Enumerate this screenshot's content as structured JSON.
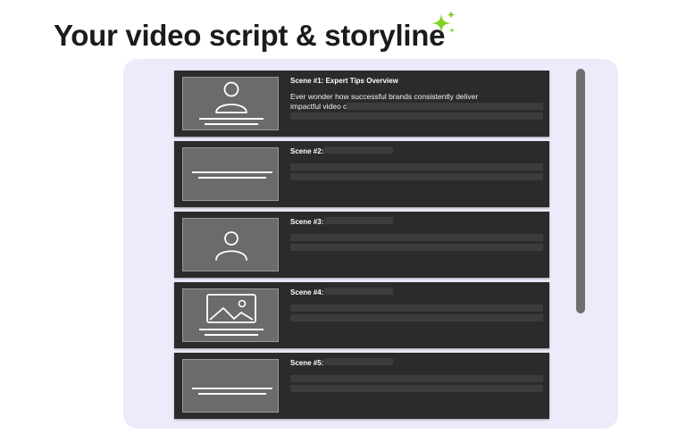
{
  "page": {
    "title": "Your video script & storyline",
    "accent_color": "#7ed321",
    "icons": [
      "sparkle-icon",
      "person-icon",
      "image-icon",
      "text-lines-icon"
    ]
  },
  "scenes": [
    {
      "title": "Scene #1: Expert Tips Overview",
      "description": "Ever wonder how successful brands consistently deliver impactful video content...",
      "thumbnail": "person-with-lines"
    },
    {
      "title": "Scene #2:",
      "description": "",
      "thumbnail": "lines"
    },
    {
      "title": "Scene #3:",
      "description": "",
      "thumbnail": "person"
    },
    {
      "title": "Scene #4:",
      "description": "",
      "thumbnail": "image-with-lines"
    },
    {
      "title": "Scene #5:",
      "description": "",
      "thumbnail": "lines"
    }
  ]
}
